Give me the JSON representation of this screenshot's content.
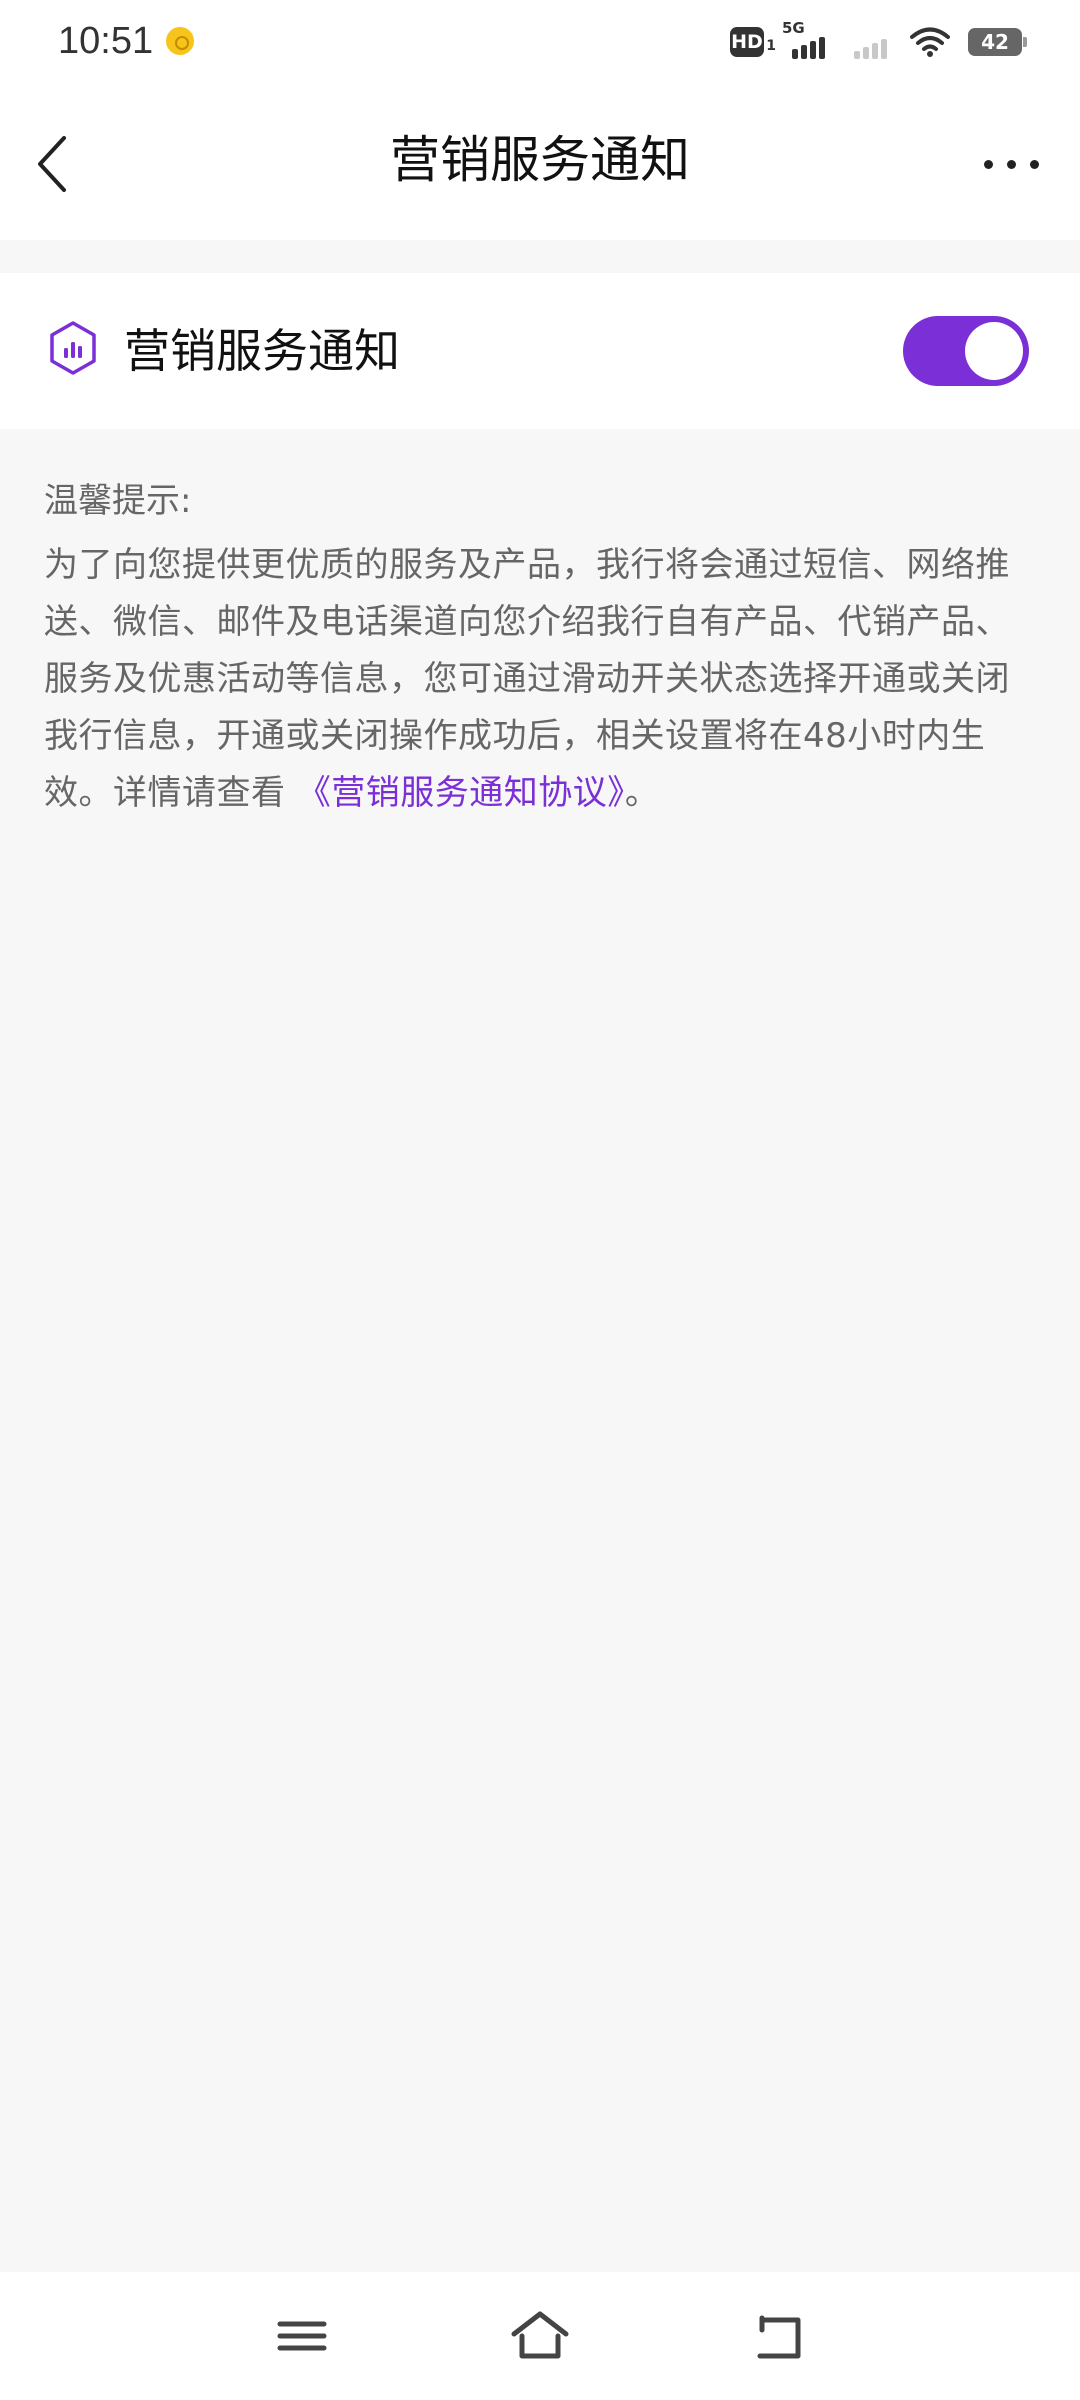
{
  "status_bar": {
    "time": "10:51",
    "hd_label": "HD",
    "hd_sub": "1",
    "network": "5G",
    "battery": "42"
  },
  "header": {
    "title": "营销服务通知"
  },
  "setting": {
    "label": "营销服务通知",
    "enabled": true
  },
  "notice": {
    "title": "温馨提示:",
    "body": "为了向您提供更优质的服务及产品，我行将会通过短信、网络推送、微信、邮件及电话渠道向您介绍我行自有产品、代销产品、服务及优惠活动等信息，您可通过滑动开关状态选择开通或关闭我行信息，开通或关闭操作成功后，相关设置将在48小时内生效。详情请查看",
    "link": "《营销服务通知协议》",
    "end": "。"
  },
  "colors": {
    "accent": "#7b2fd6",
    "background": "#f7f7f8",
    "text_secondary": "#666666"
  },
  "icons": {
    "back": "chevron-left-icon",
    "more": "more-horizontal-icon",
    "setting": "hexagon-chart-icon",
    "nav_menu": "menu-icon",
    "nav_home": "home-icon",
    "nav_back": "return-icon"
  }
}
